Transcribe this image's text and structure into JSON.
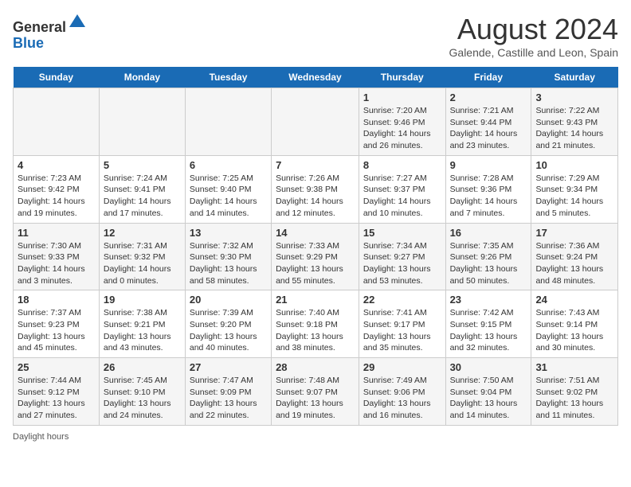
{
  "logo": {
    "general": "General",
    "blue": "Blue"
  },
  "title": "August 2024",
  "subtitle": "Galende, Castille and Leon, Spain",
  "days": [
    "Sunday",
    "Monday",
    "Tuesday",
    "Wednesday",
    "Thursday",
    "Friday",
    "Saturday"
  ],
  "weeks": [
    [
      {
        "date": "",
        "text": ""
      },
      {
        "date": "",
        "text": ""
      },
      {
        "date": "",
        "text": ""
      },
      {
        "date": "",
        "text": ""
      },
      {
        "date": "1",
        "text": "Sunrise: 7:20 AM\nSunset: 9:46 PM\nDaylight: 14 hours and 26 minutes."
      },
      {
        "date": "2",
        "text": "Sunrise: 7:21 AM\nSunset: 9:44 PM\nDaylight: 14 hours and 23 minutes."
      },
      {
        "date": "3",
        "text": "Sunrise: 7:22 AM\nSunset: 9:43 PM\nDaylight: 14 hours and 21 minutes."
      }
    ],
    [
      {
        "date": "4",
        "text": "Sunrise: 7:23 AM\nSunset: 9:42 PM\nDaylight: 14 hours and 19 minutes."
      },
      {
        "date": "5",
        "text": "Sunrise: 7:24 AM\nSunset: 9:41 PM\nDaylight: 14 hours and 17 minutes."
      },
      {
        "date": "6",
        "text": "Sunrise: 7:25 AM\nSunset: 9:40 PM\nDaylight: 14 hours and 14 minutes."
      },
      {
        "date": "7",
        "text": "Sunrise: 7:26 AM\nSunset: 9:38 PM\nDaylight: 14 hours and 12 minutes."
      },
      {
        "date": "8",
        "text": "Sunrise: 7:27 AM\nSunset: 9:37 PM\nDaylight: 14 hours and 10 minutes."
      },
      {
        "date": "9",
        "text": "Sunrise: 7:28 AM\nSunset: 9:36 PM\nDaylight: 14 hours and 7 minutes."
      },
      {
        "date": "10",
        "text": "Sunrise: 7:29 AM\nSunset: 9:34 PM\nDaylight: 14 hours and 5 minutes."
      }
    ],
    [
      {
        "date": "11",
        "text": "Sunrise: 7:30 AM\nSunset: 9:33 PM\nDaylight: 14 hours and 3 minutes."
      },
      {
        "date": "12",
        "text": "Sunrise: 7:31 AM\nSunset: 9:32 PM\nDaylight: 14 hours and 0 minutes."
      },
      {
        "date": "13",
        "text": "Sunrise: 7:32 AM\nSunset: 9:30 PM\nDaylight: 13 hours and 58 minutes."
      },
      {
        "date": "14",
        "text": "Sunrise: 7:33 AM\nSunset: 9:29 PM\nDaylight: 13 hours and 55 minutes."
      },
      {
        "date": "15",
        "text": "Sunrise: 7:34 AM\nSunset: 9:27 PM\nDaylight: 13 hours and 53 minutes."
      },
      {
        "date": "16",
        "text": "Sunrise: 7:35 AM\nSunset: 9:26 PM\nDaylight: 13 hours and 50 minutes."
      },
      {
        "date": "17",
        "text": "Sunrise: 7:36 AM\nSunset: 9:24 PM\nDaylight: 13 hours and 48 minutes."
      }
    ],
    [
      {
        "date": "18",
        "text": "Sunrise: 7:37 AM\nSunset: 9:23 PM\nDaylight: 13 hours and 45 minutes."
      },
      {
        "date": "19",
        "text": "Sunrise: 7:38 AM\nSunset: 9:21 PM\nDaylight: 13 hours and 43 minutes."
      },
      {
        "date": "20",
        "text": "Sunrise: 7:39 AM\nSunset: 9:20 PM\nDaylight: 13 hours and 40 minutes."
      },
      {
        "date": "21",
        "text": "Sunrise: 7:40 AM\nSunset: 9:18 PM\nDaylight: 13 hours and 38 minutes."
      },
      {
        "date": "22",
        "text": "Sunrise: 7:41 AM\nSunset: 9:17 PM\nDaylight: 13 hours and 35 minutes."
      },
      {
        "date": "23",
        "text": "Sunrise: 7:42 AM\nSunset: 9:15 PM\nDaylight: 13 hours and 32 minutes."
      },
      {
        "date": "24",
        "text": "Sunrise: 7:43 AM\nSunset: 9:14 PM\nDaylight: 13 hours and 30 minutes."
      }
    ],
    [
      {
        "date": "25",
        "text": "Sunrise: 7:44 AM\nSunset: 9:12 PM\nDaylight: 13 hours and 27 minutes."
      },
      {
        "date": "26",
        "text": "Sunrise: 7:45 AM\nSunset: 9:10 PM\nDaylight: 13 hours and 24 minutes."
      },
      {
        "date": "27",
        "text": "Sunrise: 7:47 AM\nSunset: 9:09 PM\nDaylight: 13 hours and 22 minutes."
      },
      {
        "date": "28",
        "text": "Sunrise: 7:48 AM\nSunset: 9:07 PM\nDaylight: 13 hours and 19 minutes."
      },
      {
        "date": "29",
        "text": "Sunrise: 7:49 AM\nSunset: 9:06 PM\nDaylight: 13 hours and 16 minutes."
      },
      {
        "date": "30",
        "text": "Sunrise: 7:50 AM\nSunset: 9:04 PM\nDaylight: 13 hours and 14 minutes."
      },
      {
        "date": "31",
        "text": "Sunrise: 7:51 AM\nSunset: 9:02 PM\nDaylight: 13 hours and 11 minutes."
      }
    ]
  ],
  "footer": "Daylight hours"
}
